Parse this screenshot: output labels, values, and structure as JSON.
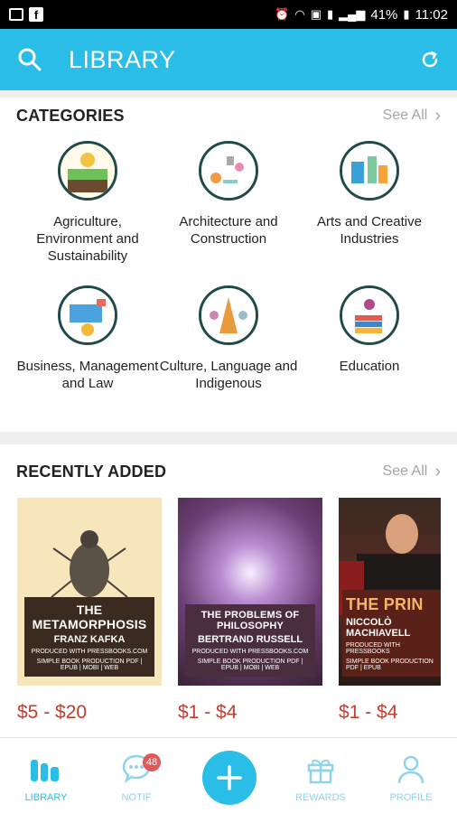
{
  "status_bar": {
    "battery": "41%",
    "time": "11:02"
  },
  "app_bar": {
    "title": "LIBRARY"
  },
  "categories": {
    "heading": "CATEGORIES",
    "see_all": "See All",
    "items": [
      {
        "label": "Agriculture, Environment and Sustainability"
      },
      {
        "label": "Architecture and Construction"
      },
      {
        "label": "Arts and Creative Industries"
      },
      {
        "label": "Business, Management and Law"
      },
      {
        "label": "Culture, Language and Indigenous"
      },
      {
        "label": "Education"
      }
    ]
  },
  "recently_added": {
    "heading": "RECENTLY ADDED",
    "see_all": "See All",
    "books": [
      {
        "title": "THE METAMORPHOSIS",
        "author": "FRANZ KAFKA",
        "produced": "PRODUCED WITH PRESSBOOKS.COM",
        "formats": "SIMPLE BOOK PRODUCTION PDF | EPUB | MOBI | WEB",
        "price": "$5 - $20"
      },
      {
        "title": "THE PROBLEMS OF PHILOSOPHY",
        "author": "BERTRAND RUSSELL",
        "produced": "PRODUCED WITH PRESSBOOKS.COM",
        "formats": "SIMPLE BOOK PRODUCTION PDF | EPUB | MOBI | WEB",
        "price": "$1 - $4"
      },
      {
        "title": "THE PRIN",
        "author": "NICCOLÒ MACHIAVELL",
        "produced": "PRODUCED WITH PRESSBOOKS",
        "formats": "SIMPLE BOOK PRODUCTION PDF | EPUB",
        "price": "$1 - $4"
      }
    ]
  },
  "bottom_nav": {
    "items": [
      {
        "label": "LIBRARY"
      },
      {
        "label": "NOTIF",
        "badge": "48"
      },
      {
        "label": "REWARDS"
      },
      {
        "label": "PROFILE"
      }
    ]
  }
}
